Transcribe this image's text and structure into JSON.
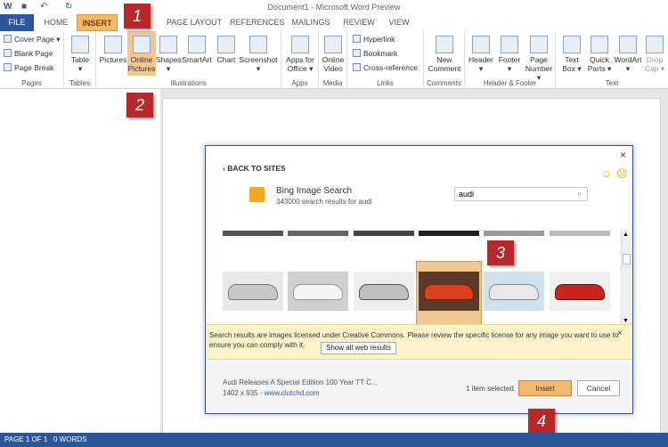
{
  "window": {
    "title": "Document1 - Microsoft Word Preview"
  },
  "tabs": [
    "FILE",
    "HOME",
    "INSERT",
    "PAGE LAYOUT",
    "REFERENCES",
    "MAILINGS",
    "REVIEW",
    "VIEW"
  ],
  "ribbon": {
    "pages": {
      "cover_page": "Cover Page",
      "blank_page": "Blank Page",
      "page_break": "Page Break",
      "label": "Pages"
    },
    "tables": {
      "table": "Table",
      "label": "Tables"
    },
    "illustrations": {
      "pictures": "Pictures",
      "online1": "Online",
      "online2": "Pictures",
      "shapes": "Shapes",
      "smartart": "SmartArt",
      "chart": "Chart",
      "screenshot": "Screenshot",
      "label": "Illustrations"
    },
    "apps": {
      "apps1": "Apps for",
      "apps2": "Office",
      "label": "Apps"
    },
    "media": {
      "video1": "Online",
      "video2": "Video",
      "label": "Media"
    },
    "links": {
      "hyperlink": "Hyperlink",
      "bookmark": "Bookmark",
      "crossref": "Cross-reference",
      "label": "Links"
    },
    "comments": {
      "new1": "New",
      "new2": "Comment",
      "label": "Comments"
    },
    "headerfooter": {
      "header": "Header",
      "footer": "Footer",
      "page1": "Page",
      "page2": "Number",
      "label": "Header & Footer"
    },
    "text": {
      "textbox1": "Text",
      "textbox2": "Box",
      "quick1": "Quick",
      "quick2": "Parts",
      "wordart": "WordArt",
      "drop1": "Drop",
      "drop2": "Cap",
      "label": "Text"
    }
  },
  "callouts": [
    "1",
    "2",
    "3",
    "4"
  ],
  "dialog": {
    "back": "BACK TO SITES",
    "source_title": "Bing Image Search",
    "source_subtitle": "343000 search results for audi",
    "search_value": "audi",
    "notice": "Search results are images licensed under Creative Commons. Please review the specific license for any image you want to use to ensure you can comply with it.",
    "show_all": "Show all web results",
    "selected_title": "Audi Releases A Special Edition 100 Year TT C...",
    "selected_size": "1402 x 935 - ",
    "selected_source": "www.clutchd.com",
    "count": "1 item selected.",
    "insert": "Insert",
    "cancel": "Cancel",
    "close": "×"
  },
  "status": {
    "page": "PAGE 1 OF 1",
    "words": "0 WORDS"
  }
}
